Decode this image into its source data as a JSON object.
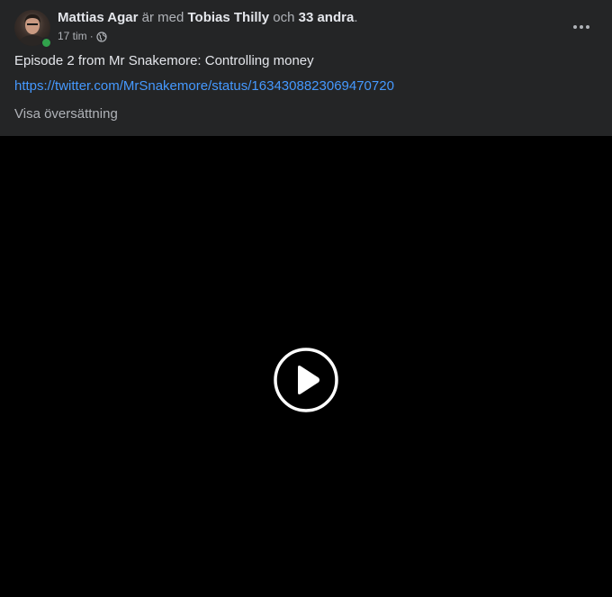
{
  "post": {
    "author": "Mattias Agar",
    "with_text": "är med",
    "tagged_name": "Tobias Thilly",
    "and_text": "och",
    "others": "33 andra",
    "period": ".",
    "timestamp": "17 tim",
    "separator": "·",
    "privacy_icon": "globe-icon",
    "text": "Episode 2 from Mr Snakemore: Controlling money",
    "link": "https://twitter.com/MrSnakemore/status/1634308823069470720",
    "translate_label": "Visa översättning"
  },
  "video": {
    "play_icon": "play-icon"
  },
  "colors": {
    "card_background": "#242526",
    "primary_text": "#e4e6eb",
    "secondary_text": "#b0b3b8",
    "link": "#4599ff",
    "online": "#31a24c",
    "video_background": "#000000"
  }
}
